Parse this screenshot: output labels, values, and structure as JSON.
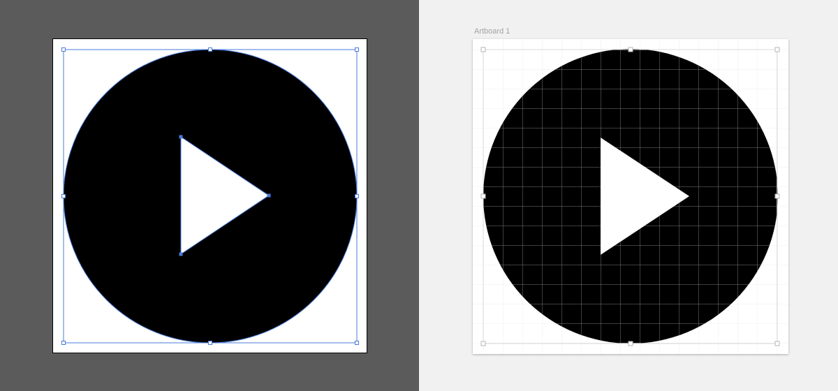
{
  "illustrator_view": {
    "background": "#5b5b5b",
    "shape": "play-button",
    "selection_color": "#4a7bd8",
    "circle_fill": "#000000",
    "triangle_fill": "#ffffff"
  },
  "sketch_view": {
    "background": "#f1f1f1",
    "artboard_label": "Artboard 1",
    "shape": "play-button",
    "grid_color": "#7a7a7a",
    "circle_fill": "#000000",
    "triangle_fill": "#ffffff"
  }
}
